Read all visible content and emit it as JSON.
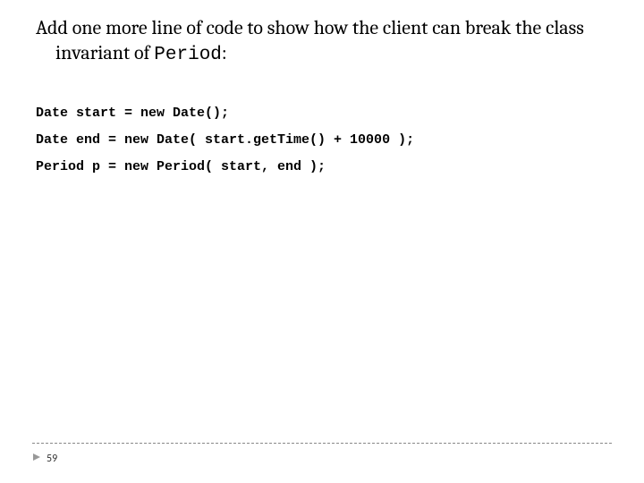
{
  "heading": {
    "line1_prefix": "Add one more line of code to show how the client can break",
    "line2_prefix": "the class invariant of ",
    "mono": "Period",
    "line2_suffix": ":"
  },
  "code": {
    "l1": "Date start = new Date();",
    "l2": "Date end = new Date( start.getTime() + 10000 );",
    "l3": "Period p = new Period( start, end );"
  },
  "page_number": "59"
}
